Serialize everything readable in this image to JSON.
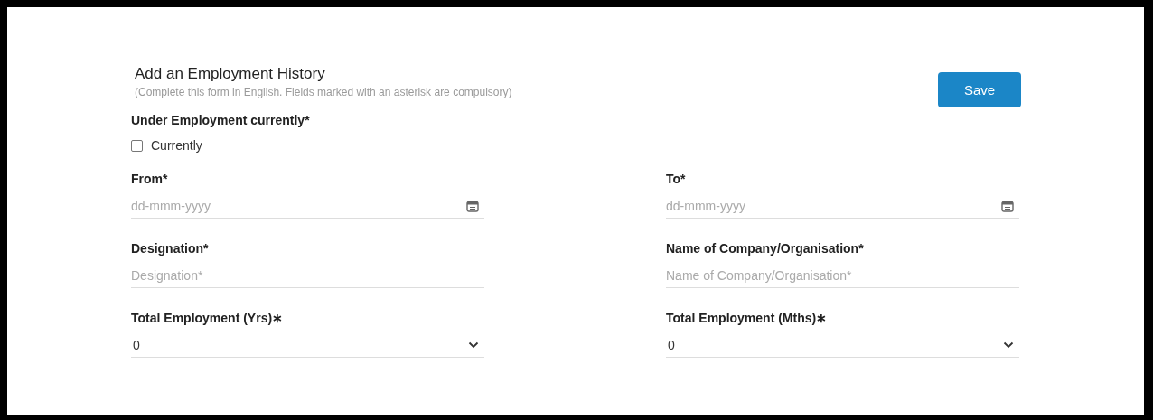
{
  "form": {
    "title": "Add an Employment History",
    "subtitle": "(Complete this form in English. Fields marked with an asterisk are compulsory)",
    "save_button": "Save"
  },
  "current": {
    "label": "Under Employment currently*",
    "option": "Currently",
    "checked": false
  },
  "fields": [
    {
      "kind": "date",
      "label": "From*",
      "placeholder": "dd-mmm-yyyy"
    },
    {
      "kind": "date",
      "label": "To*",
      "placeholder": "dd-mmm-yyyy"
    },
    {
      "kind": "text",
      "label": "Designation*",
      "placeholder": "Designation*"
    },
    {
      "kind": "text",
      "label": "Name of Company/Organisation*",
      "placeholder": "Name of Company/Organisation*"
    },
    {
      "kind": "select",
      "label": "Total Employment (Yrs)∗",
      "value": "0"
    },
    {
      "kind": "select",
      "label": "Total Employment (Mths)∗",
      "value": "0"
    }
  ]
}
